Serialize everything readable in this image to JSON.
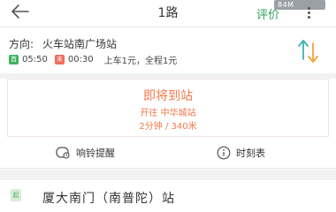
{
  "header": {
    "title": "1路",
    "rate_label": "评价",
    "status_text": "84M"
  },
  "route": {
    "direction_label": "方向:",
    "destination": "火车站南广场站",
    "first_badge": "首",
    "first_time": "05:50",
    "last_badge": "末",
    "last_time": "00:30",
    "fare": "上车1元，全程1元"
  },
  "arrival": {
    "title": "即将到站",
    "station": "开往 中华城站",
    "eta": "2分钟 / 340米"
  },
  "actions": {
    "ring_label": "响铃提醒",
    "timetable_label": "时刻表"
  },
  "stop": {
    "badge": "起",
    "name": "厦大南门（南普陀）站"
  },
  "colors": {
    "accent_green": "#2f9e5a",
    "arrival_orange": "#f2784b"
  }
}
